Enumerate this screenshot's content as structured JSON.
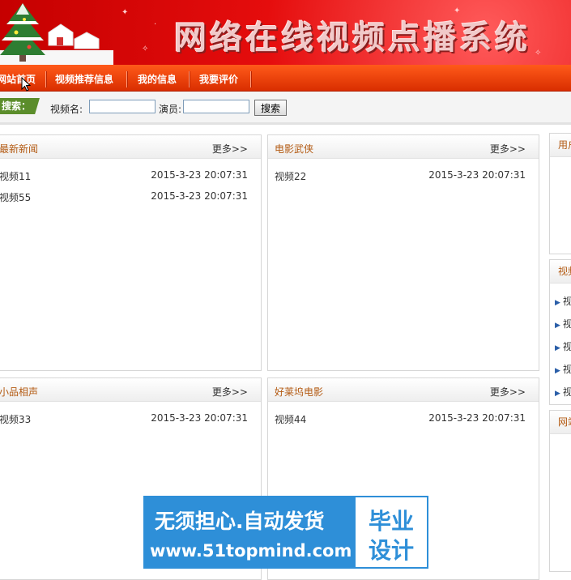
{
  "banner": {
    "title": "网络在线视频点播系统"
  },
  "nav": {
    "items": [
      {
        "label": "网站首页"
      },
      {
        "label": "视频推荐信息"
      },
      {
        "label": "我的信息"
      },
      {
        "label": "我要评价"
      }
    ]
  },
  "search": {
    "tag": "搜索：",
    "video_name_label": "视频名:",
    "video_name_value": "",
    "actor_label": "演员:",
    "actor_value": "",
    "button_label": "搜索"
  },
  "panels": [
    {
      "title": "最新新闻",
      "more": "更多>>",
      "rows": [
        {
          "name": "视频11",
          "date": "2015-3-23 20:07:31"
        },
        {
          "name": "视频55",
          "date": "2015-3-23 20:07:31"
        }
      ]
    },
    {
      "title": "电影武侠",
      "more": "更多>>",
      "rows": [
        {
          "name": "视频22",
          "date": "2015-3-23 20:07:31"
        }
      ]
    },
    {
      "title": "小品相声",
      "more": "更多>>",
      "rows": [
        {
          "name": "视频33",
          "date": "2015-3-23 20:07:31"
        }
      ]
    },
    {
      "title": "好莱坞电影",
      "more": "更多>>",
      "rows": [
        {
          "name": "视频44",
          "date": "2015-3-23 20:07:31"
        }
      ]
    }
  ],
  "sidebar": {
    "user_head": "用户",
    "video_head": "视频",
    "video_items": [
      "视",
      "视",
      "视",
      "视",
      "视"
    ],
    "site_head": "网站"
  },
  "ad": {
    "line1": "无须担心.自动发货",
    "line2": "www.51topmind.com",
    "box_line1": "毕业",
    "box_line2": "设计"
  },
  "colors": {
    "nav_bg": "#e83a06",
    "banner_bg": "#e50d0d",
    "panel_title": "#b35a12",
    "ad_bg": "#2e8fd8"
  }
}
